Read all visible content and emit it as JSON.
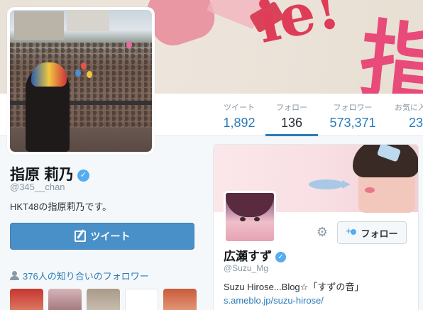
{
  "banner": {
    "glyph_left": "ie!",
    "glyph_right": "指"
  },
  "stats": [
    {
      "label": "ツイート",
      "value": "1,892"
    },
    {
      "label": "フォロー",
      "value": "136"
    },
    {
      "label": "フォロワー",
      "value": "573,371"
    },
    {
      "label": "お気に入",
      "value": "23"
    }
  ],
  "profile": {
    "name": "指原 莉乃",
    "handle": "@345__chan",
    "bio": "HKT48の指原莉乃です。",
    "tweet_button": "ツイート",
    "followers_you_know": "376人の知り合いのフォロワー"
  },
  "suggested": {
    "name": "広瀬すず",
    "handle": "@Suzu_Mg",
    "follow_button": "フォロー",
    "bio_text": "Suzu Hirose...Blog☆「すずの音」",
    "bio_link": "s.ameblo.jp/suzu-hirose/"
  },
  "colors": {
    "accent": "#2b7bb9",
    "button": "#4a90c8",
    "verified": "#55acee"
  },
  "icons": [
    "verified-icon",
    "quill-icon",
    "person-icon",
    "gear-icon",
    "follow-person-icon"
  ]
}
